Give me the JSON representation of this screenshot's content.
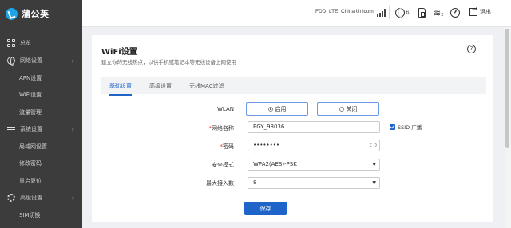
{
  "brand": {
    "name": "蒲公英"
  },
  "sidebar": {
    "items": [
      {
        "label": "总览",
        "icon": "dashboard-icon"
      },
      {
        "label": "网络设置",
        "icon": "globe-icon"
      },
      {
        "label": "APN设置"
      },
      {
        "label": "WiFi设置"
      },
      {
        "label": "流量管理"
      },
      {
        "label": "系统设置",
        "icon": "sliders-icon"
      },
      {
        "label": "局域网设置"
      },
      {
        "label": "修改密码"
      },
      {
        "label": "重启复位"
      },
      {
        "label": "高级设置",
        "icon": "gear-icon"
      },
      {
        "label": "SIM切换"
      }
    ]
  },
  "topbar": {
    "network_type": "FDD_LTE",
    "carrier": "China Unicom",
    "wifi_count": "2",
    "logout_label": "退出"
  },
  "page": {
    "title": "WiFi设置",
    "subtitle": "建立你的无线热点，以供手机或笔记本等无线设备上网使用",
    "help_glyph": "?"
  },
  "tabs": [
    {
      "label": "基础设置",
      "active": true
    },
    {
      "label": "高级设置",
      "active": false
    },
    {
      "label": "无线MAC过滤",
      "active": false
    }
  ],
  "form": {
    "wlan": {
      "label": "WLAN",
      "on_label": "启用",
      "off_label": "关闭",
      "selected": "启用"
    },
    "ssid": {
      "required": "*",
      "label": "网络名称",
      "value": "PGY_98036",
      "broadcast_label": "SSID 广播",
      "broadcast_checked": true
    },
    "password": {
      "required": "*",
      "label": "密码",
      "value": "••••••••"
    },
    "security": {
      "label": "安全模式",
      "value": "WPA2(AES)-PSK"
    },
    "max_clients": {
      "label": "最大接入数",
      "value": "8"
    },
    "save_label": "保存"
  },
  "colors": {
    "accent": "#1f64c8",
    "sidebar": "#3c3c3c",
    "logo": "#1fa3e8"
  }
}
